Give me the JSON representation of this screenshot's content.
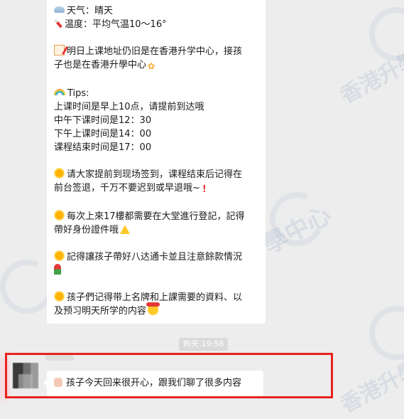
{
  "message": {
    "weather": "天气：晴天",
    "temperature": "温度：平均气温10～16°",
    "notice_line1": "明日上课地址仍旧是在香港升学中心，接孩",
    "notice_line2": "子也是在香港升學中心",
    "tips_heading": "Tips:",
    "tips_line1": "上课时间是早上10点，请提前到达哦",
    "tips_line2": "中午下课时间是12：30",
    "tips_line3": "下午上课时间是14：00",
    "tips_line4": "课程结束时间是17：00",
    "signin_line1": "请大家提前到现场签到，课程结束后记得在",
    "signin_line2": "前台签退，千万不要迟到或早退哦~",
    "register_line1": "每次上來17樓都需要在大堂進行登記，記得",
    "register_line2": "帶好身份證件哦",
    "card_line1": "記得讓孩子帶好八达通卡並且注意餘款情況",
    "items_line1": "孩子們记得带上名牌和上課需要的資料、以",
    "items_line2": "及预习明天所学的内容"
  },
  "timestamp": "昨天 19:58",
  "reply": {
    "text": "孩子今天回来很开心，跟我们聊了很多内容"
  },
  "watermark": {
    "text": "香港升學中心"
  },
  "colors": {
    "highlight": "#e8221e",
    "background": "#ededed",
    "bubble": "#ffffff"
  }
}
